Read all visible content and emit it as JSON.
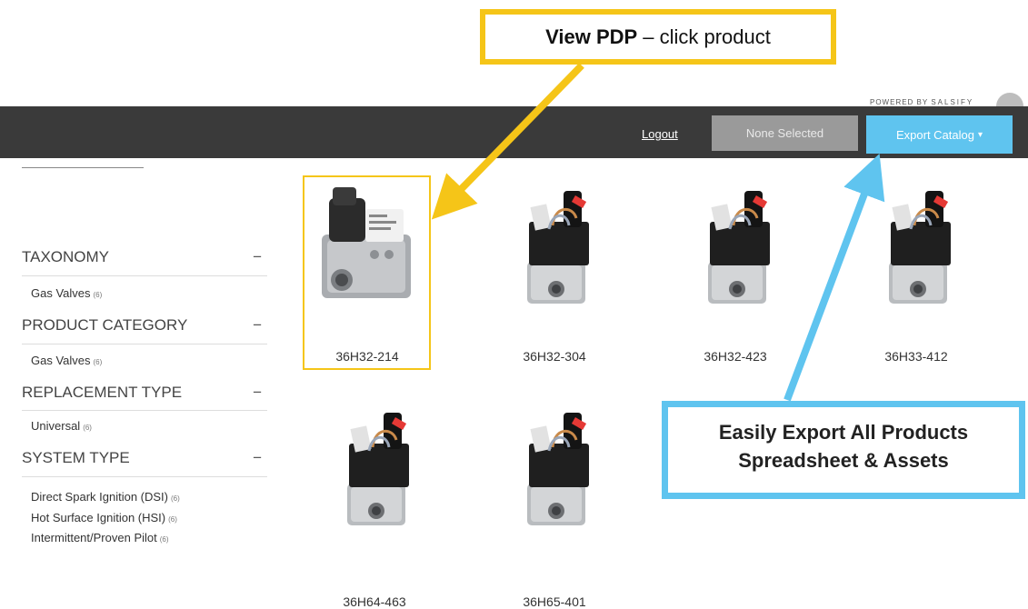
{
  "powered_by": {
    "prefix": "POWERED BY",
    "brand": "SALSIFY"
  },
  "header": {
    "logout_label": "Logout",
    "selection_label": "None Selected",
    "export_label": "Export Catalog",
    "export_caret": "▾"
  },
  "facets": [
    {
      "title": "TAXONOMY",
      "toggle": "−",
      "items": [
        {
          "label": "Gas Valves",
          "count": "(6)"
        }
      ]
    },
    {
      "title": "PRODUCT CATEGORY",
      "toggle": "−",
      "items": [
        {
          "label": "Gas Valves",
          "count": "(6)"
        }
      ]
    },
    {
      "title": "REPLACEMENT TYPE",
      "toggle": "−",
      "items": [
        {
          "label": "Universal",
          "count": "(6)"
        }
      ]
    },
    {
      "title": "SYSTEM TYPE",
      "toggle": "−",
      "items": [
        {
          "label": "Direct Spark Ignition (DSI)",
          "count": "(6)"
        },
        {
          "label": "Hot Surface Ignition (HSI)",
          "count": "(6)"
        },
        {
          "label": "Intermittent/Proven Pilot",
          "count": "(6)"
        }
      ]
    }
  ],
  "products": [
    {
      "name": "36H32-214",
      "image": "gas-valve-with-white-control-icon"
    },
    {
      "name": "36H32-304",
      "image": "gas-valve-with-red-wire-icon"
    },
    {
      "name": "36H32-423",
      "image": "gas-valve-with-red-wire-icon"
    },
    {
      "name": "36H33-412",
      "image": "gas-valve-with-red-wire-icon"
    },
    {
      "name": "36H64-463",
      "image": "gas-valve-with-red-wire-icon"
    },
    {
      "name": "36H65-401",
      "image": "gas-valve-with-red-wire-icon"
    }
  ],
  "callouts": {
    "view_pdp_bold": "View PDP",
    "view_pdp_rest": "– click product",
    "export_line1": "Easily Export All Products",
    "export_line2": "Spreadsheet & Assets"
  },
  "colors": {
    "yellow": "#f5c518",
    "blue": "#5fc4ef",
    "header_bg": "#3a3a3a"
  }
}
